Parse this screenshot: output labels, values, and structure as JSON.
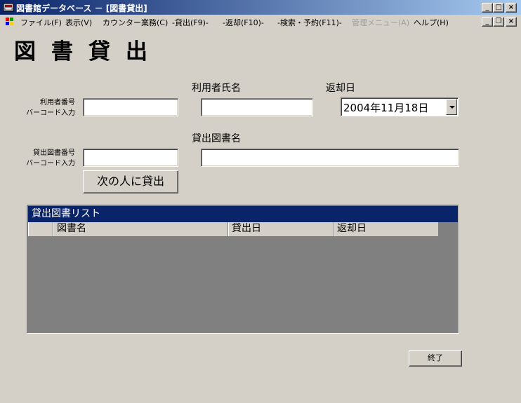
{
  "window": {
    "title": "図書館データベース － [図書貸出]",
    "min_glyph": "_",
    "max_glyph": "□",
    "close_glyph": "×",
    "restore_glyph": "❐"
  },
  "menu": [
    {
      "label": "ファイル(F)",
      "enabled": true
    },
    {
      "label": "表示(V)",
      "enabled": true
    },
    {
      "label": "カウンター業務(C)",
      "enabled": true
    },
    {
      "label": "-貸出(F9)-",
      "enabled": true
    },
    {
      "label": "-返却(F10)-",
      "enabled": true
    },
    {
      "label": "-検索・予約(F11)-",
      "enabled": true
    },
    {
      "label": "管理メニュー(A)",
      "enabled": false
    },
    {
      "label": "ヘルプ(H)",
      "enabled": true
    }
  ],
  "page_title": "図書貸出",
  "form": {
    "user_number_label_line1": "利用者番号",
    "user_number_label_line2": "バーコード入力",
    "user_number_value": "",
    "user_name_label": "利用者氏名",
    "user_name_value": "",
    "return_date_label": "返却日",
    "return_date_value": "2004年11月18日",
    "book_number_label_line1": "貸出図書番号",
    "book_number_label_line2": "バーコード入力",
    "book_number_value": "",
    "book_title_label": "貸出図書名",
    "book_title_value": "",
    "next_person_button": "次の人に貸出"
  },
  "loan_list": {
    "caption": "貸出図書リスト",
    "columns": [
      "",
      "図書名",
      "貸出日",
      "返却日"
    ],
    "rows": []
  },
  "exit_button": "終了"
}
